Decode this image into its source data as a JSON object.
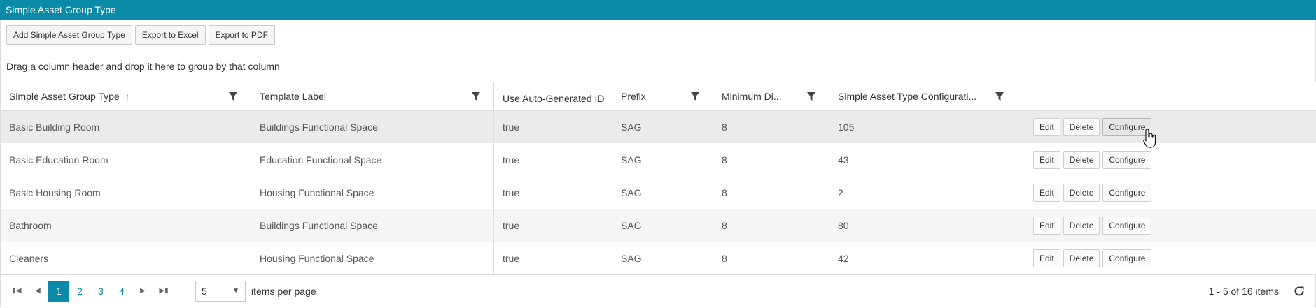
{
  "window": {
    "title": "Simple Asset Group Type"
  },
  "toolbar": {
    "add_label": "Add Simple Asset Group Type",
    "excel_label": "Export to Excel",
    "pdf_label": "Export to PDF"
  },
  "group_zone": {
    "text": "Drag a column header and drop it here to group by that column"
  },
  "grid": {
    "columns": [
      {
        "label": "Simple Asset Group Type",
        "sorted": "asc",
        "filter": true
      },
      {
        "label": "Template Label",
        "filter": true
      },
      {
        "label": "Use Auto-Generated ID",
        "filter": false
      },
      {
        "label": "Prefix",
        "filter": true
      },
      {
        "label": "Minimum Di...",
        "filter": true
      },
      {
        "label": "Simple Asset Type Configurati...",
        "filter": true
      },
      {
        "label": "",
        "filter": false
      }
    ],
    "sort_indicator": "↑",
    "rows": [
      {
        "type": "Basic Building Room",
        "template": "Buildings Functional Space",
        "auto_id": "true",
        "prefix": "SAG",
        "min_digits": "8",
        "config": "105"
      },
      {
        "type": "Basic Education Room",
        "template": "Education Functional Space",
        "auto_id": "true",
        "prefix": "SAG",
        "min_digits": "8",
        "config": "43"
      },
      {
        "type": "Basic Housing Room",
        "template": "Housing Functional Space",
        "auto_id": "true",
        "prefix": "SAG",
        "min_digits": "8",
        "config": "2"
      },
      {
        "type": "Bathroom",
        "template": "Buildings Functional Space",
        "auto_id": "true",
        "prefix": "SAG",
        "min_digits": "8",
        "config": "80"
      },
      {
        "type": "Cleaners",
        "template": "Housing Functional Space",
        "auto_id": "true",
        "prefix": "SAG",
        "min_digits": "8",
        "config": "42"
      }
    ],
    "row_actions": {
      "edit": "Edit",
      "delete": "Delete",
      "configure": "Configure"
    }
  },
  "pager": {
    "pages": [
      "1",
      "2",
      "3",
      "4"
    ],
    "current_page": "1",
    "page_size": "5",
    "per_page_label": "items per page",
    "info": "1 - 5 of 16 items"
  },
  "icons": {
    "filter": "filter-icon",
    "refresh": "refresh-icon",
    "first": "first-page-icon",
    "prev": "prev-page-icon",
    "next": "next-page-icon",
    "last": "last-page-icon",
    "cursor": "hand-cursor-icon"
  },
  "colors": {
    "accent": "#0a8aa6",
    "row_alt": "#f5f5f5",
    "row_hover": "#ebebeb"
  }
}
